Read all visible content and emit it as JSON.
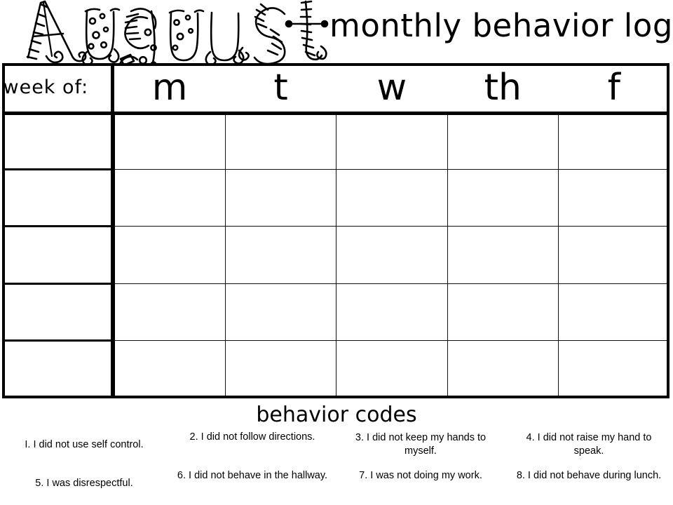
{
  "page": {
    "month_title": "August",
    "header_title": "monthly behavior log",
    "ink_color": "#000000",
    "paper_color": "#ffffff"
  },
  "table": {
    "week_column_header": "week of:",
    "day_headers": [
      {
        "key": "monday",
        "label": "m"
      },
      {
        "key": "tuesday",
        "label": "t"
      },
      {
        "key": "wednesday",
        "label": "w"
      },
      {
        "key": "thursday",
        "label": "th"
      },
      {
        "key": "friday",
        "label": "f"
      }
    ],
    "rows": [
      {
        "week_of": "",
        "m": "",
        "t": "",
        "w": "",
        "th": "",
        "f": ""
      },
      {
        "week_of": "",
        "m": "",
        "t": "",
        "w": "",
        "th": "",
        "f": ""
      },
      {
        "week_of": "",
        "m": "",
        "t": "",
        "w": "",
        "th": "",
        "f": ""
      },
      {
        "week_of": "",
        "m": "",
        "t": "",
        "w": "",
        "th": "",
        "f": ""
      },
      {
        "week_of": "",
        "m": "",
        "t": "",
        "w": "",
        "th": "",
        "f": ""
      }
    ]
  },
  "behavior_codes": {
    "heading": "behavior codes",
    "items": [
      {
        "number": "1.",
        "text": "I. I did not use self control."
      },
      {
        "number": "2.",
        "text": "2. I did not follow directions."
      },
      {
        "number": "3.",
        "text": "3.  I did not keep my hands to myself."
      },
      {
        "number": "4.",
        "text": "4.  I did not raise my hand to speak."
      },
      {
        "number": "5.",
        "text": "5.  I was disrespectful."
      },
      {
        "number": "6.",
        "text": "6.  I did not behave in the hallway."
      },
      {
        "number": "7.",
        "text": "7.  I was not doing my work."
      },
      {
        "number": "8.",
        "text": "8.  I did not behave during lunch."
      }
    ]
  }
}
